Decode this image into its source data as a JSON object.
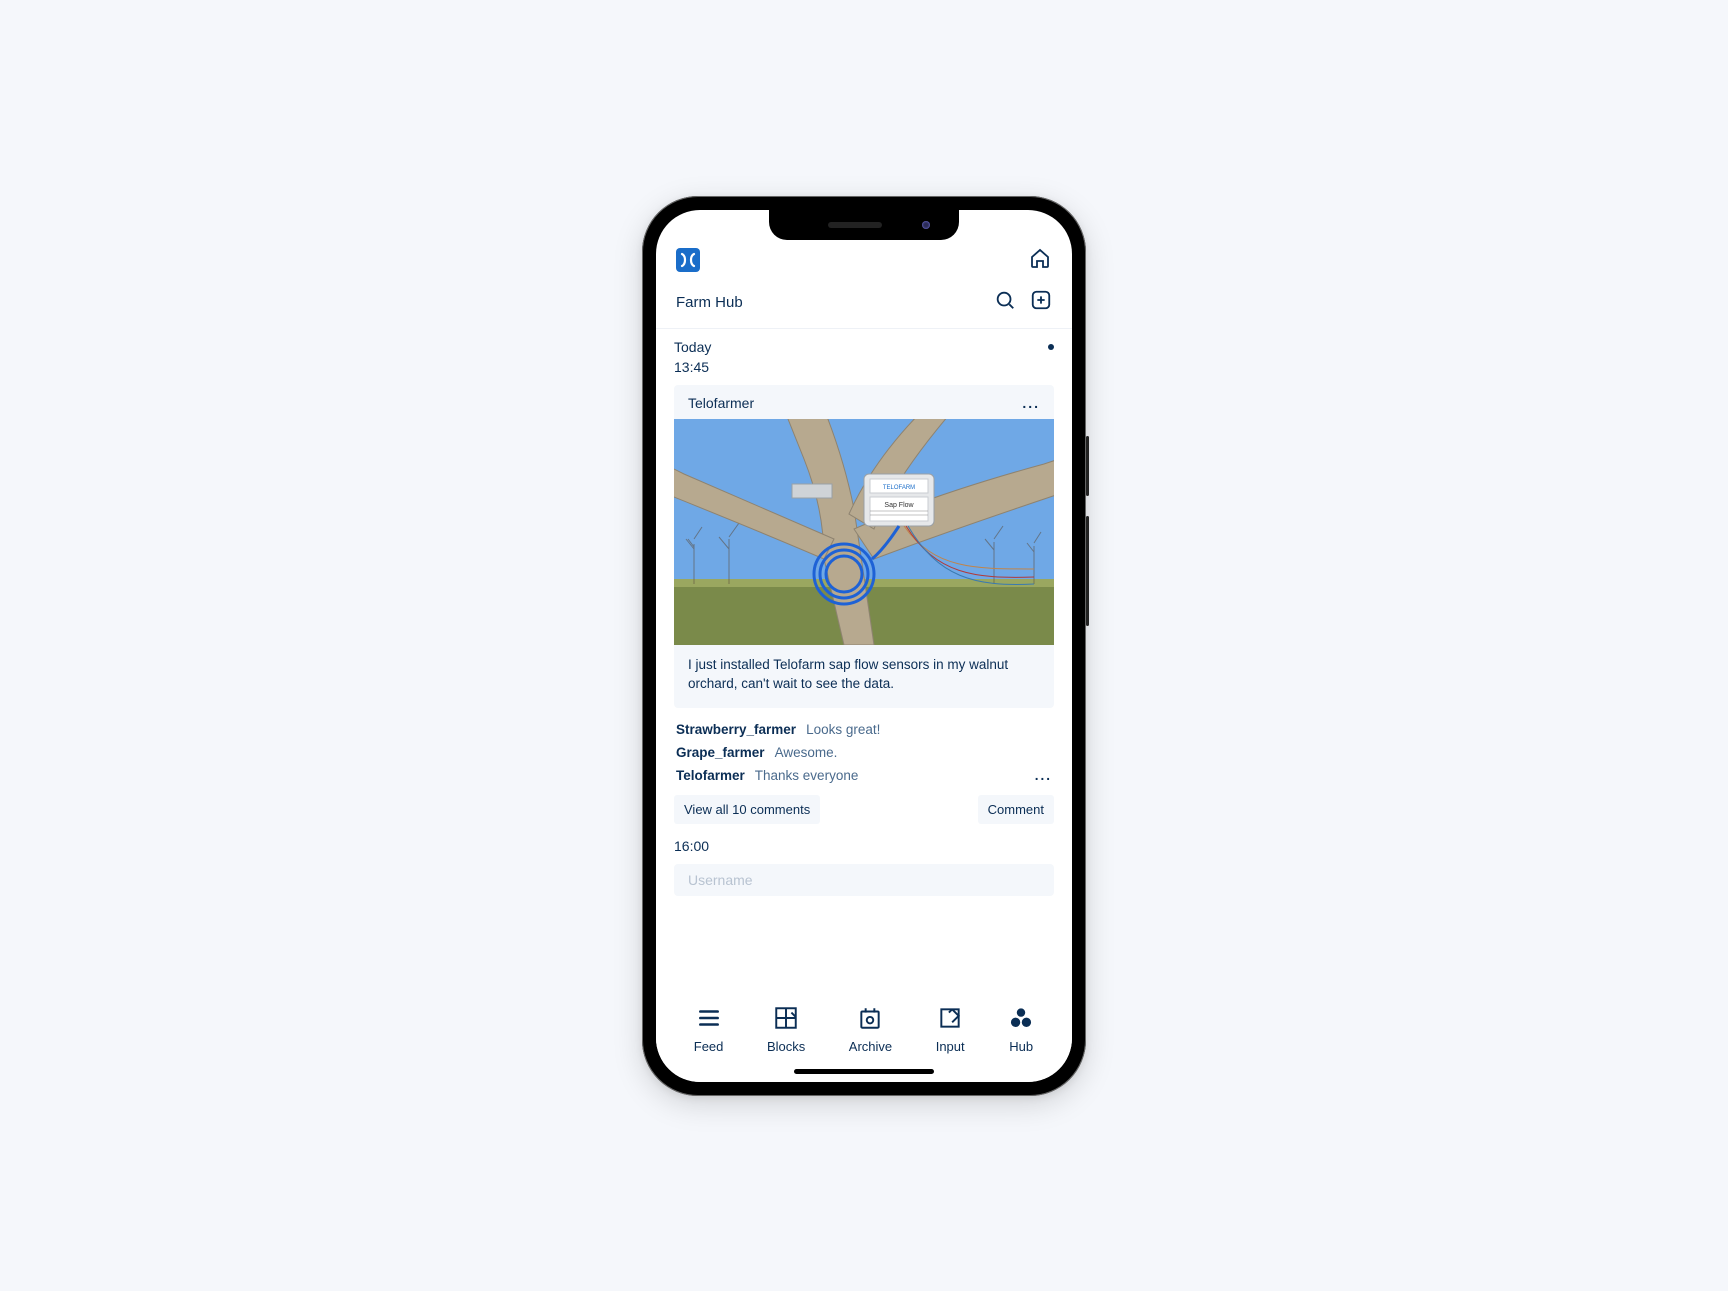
{
  "topBar": {
    "homeAria": "home"
  },
  "header": {
    "title": "Farm Hub",
    "searchAria": "search",
    "addAria": "add"
  },
  "feed": {
    "dayLabel": "Today",
    "time1": "13:45",
    "post": {
      "author": "Telofarmer",
      "caption": "I just installed Telofarm sap flow sensors in my walnut orchard, can't wait to see the data.",
      "imageAlt": "Sap flow sensor mounted on walnut tree"
    },
    "comments": [
      {
        "user": "Strawberry_farmer",
        "text": "Looks great!"
      },
      {
        "user": "Grape_farmer",
        "text": "Awesome."
      },
      {
        "user": "Telofarmer",
        "text": "Thanks everyone"
      }
    ],
    "viewAllLabel": "View all 10 comments",
    "commentBtn": "Comment",
    "time2": "16:00",
    "nextCardPlaceholder": "Username"
  },
  "nav": {
    "feed": "Feed",
    "blocks": "Blocks",
    "archive": "Archive",
    "input": "Input",
    "hub": "Hub"
  }
}
